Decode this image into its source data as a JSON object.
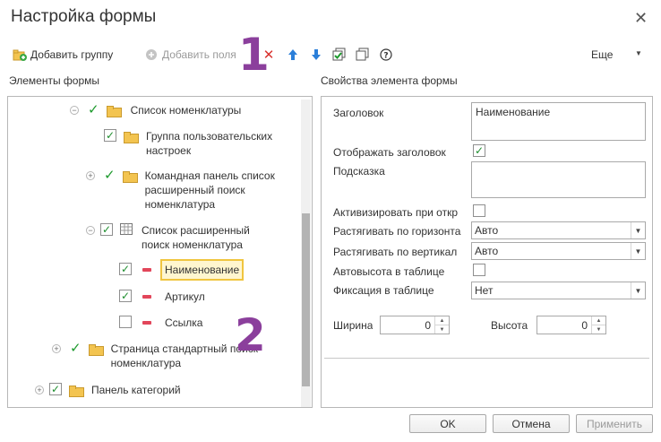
{
  "window": {
    "title": "Настройка формы"
  },
  "toolbar": {
    "add_group": "Добавить группу",
    "add_field": "Добавить поля",
    "more": "Еще"
  },
  "annotations": {
    "one": "1",
    "two": "2"
  },
  "left": {
    "heading": "Элементы формы"
  },
  "tree": {
    "item1": "Список номенклатуры",
    "item2": "Группа пользовательских настроек",
    "item3": "Командная панель список расширенный поиск номенклатура",
    "item4": "Список расширенный поиск номенклатура",
    "item5": "Наименование",
    "item6": "Артикул",
    "item7": "Ссылка",
    "item8": "Страница стандартный поиск номенклатура",
    "item9": "Панель категорий"
  },
  "props": {
    "heading": "Свойства элемента формы",
    "title_label": "Заголовок",
    "title_value": "Наименование",
    "show_title_label": "Отображать заголовок",
    "hint_label": "Подсказка",
    "activate_label": "Активизировать при откр",
    "stretch_h_label": "Растягивать по горизонта",
    "stretch_h_value": "Авто",
    "stretch_v_label": "Растягивать по вертикал",
    "stretch_v_value": "Авто",
    "autoheight_label": "Автовысота в таблице",
    "fix_label": "Фиксация в таблице",
    "fix_value": "Нет",
    "width_label": "Ширина",
    "width_value": "0",
    "height_label": "Высота",
    "height_value": "0"
  },
  "footer": {
    "ok": "OK",
    "cancel": "Отмена",
    "apply": "Применить"
  }
}
